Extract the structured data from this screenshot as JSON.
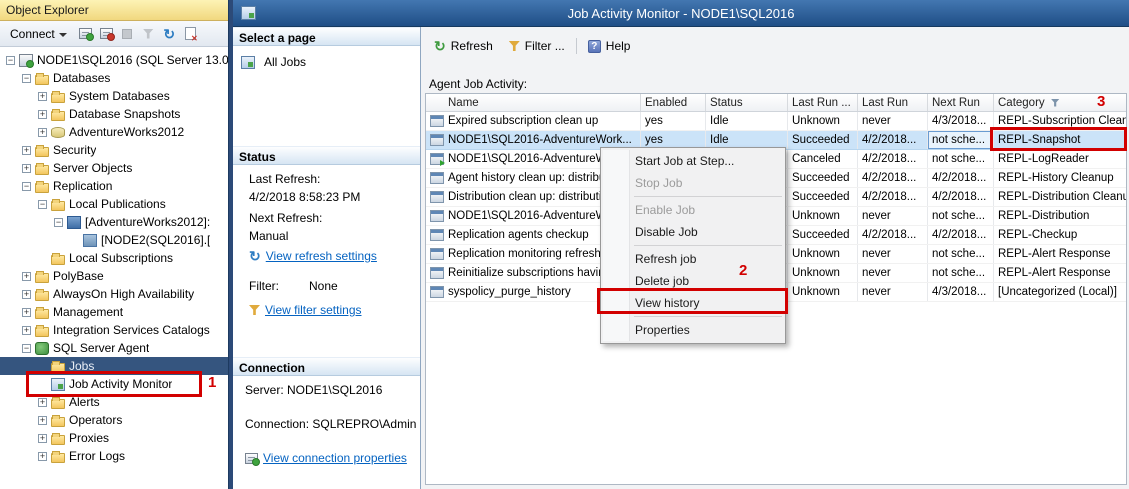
{
  "colors": {
    "annotation_red": "#d20000",
    "titlebar_blue": "#2a62a5",
    "selection_blue": "#cbe3f8",
    "link_blue": "#0563c1",
    "object_explorer_gold": "#f1d87f"
  },
  "object_explorer": {
    "title": "Object Explorer",
    "connect_label": "Connect",
    "tree": [
      {
        "label": "NODE1\\SQL2016 (SQL Server 13.0.",
        "level": 0,
        "expander": "minus",
        "icon": "server"
      },
      {
        "label": "Databases",
        "level": 1,
        "expander": "minus",
        "icon": "folder"
      },
      {
        "label": "System Databases",
        "level": 2,
        "expander": "plus",
        "icon": "folder"
      },
      {
        "label": "Database Snapshots",
        "level": 2,
        "expander": "plus",
        "icon": "folder"
      },
      {
        "label": "AdventureWorks2012",
        "level": 2,
        "expander": "plus",
        "icon": "database"
      },
      {
        "label": "Security",
        "level": 1,
        "expander": "plus",
        "icon": "folder"
      },
      {
        "label": "Server Objects",
        "level": 1,
        "expander": "plus",
        "icon": "folder"
      },
      {
        "label": "Replication",
        "level": 1,
        "expander": "minus",
        "icon": "folder"
      },
      {
        "label": "Local Publications",
        "level": 2,
        "expander": "minus",
        "icon": "folder"
      },
      {
        "label": "[AdventureWorks2012]:",
        "level": 3,
        "expander": "minus",
        "icon": "publication"
      },
      {
        "label": "[NODE2(SQL2016].[",
        "level": 4,
        "expander": "none",
        "icon": "subscription"
      },
      {
        "label": "Local Subscriptions",
        "level": 2,
        "expander": "none",
        "icon": "folder"
      },
      {
        "label": "PolyBase",
        "level": 1,
        "expander": "plus",
        "icon": "folder"
      },
      {
        "label": "AlwaysOn High Availability",
        "level": 1,
        "expander": "plus",
        "icon": "folder"
      },
      {
        "label": "Management",
        "level": 1,
        "expander": "plus",
        "icon": "folder"
      },
      {
        "label": "Integration Services Catalogs",
        "level": 1,
        "expander": "plus",
        "icon": "folder"
      },
      {
        "label": "SQL Server Agent",
        "level": 1,
        "expander": "minus",
        "icon": "agent"
      },
      {
        "label": "Jobs",
        "level": 2,
        "expander": "none",
        "icon": "folder",
        "selected": true
      },
      {
        "label": "Job Activity Monitor",
        "level": 2,
        "expander": "none",
        "icon": "monitor"
      },
      {
        "label": "Alerts",
        "level": 2,
        "expander": "plus",
        "icon": "folder"
      },
      {
        "label": "Operators",
        "level": 2,
        "expander": "plus",
        "icon": "folder"
      },
      {
        "label": "Proxies",
        "level": 2,
        "expander": "plus",
        "icon": "folder"
      },
      {
        "label": "Error Logs",
        "level": 2,
        "expander": "plus",
        "icon": "folder"
      }
    ]
  },
  "window": {
    "title": "Job Activity Monitor - NODE1\\SQL2016"
  },
  "select_page": {
    "header": "Select a page",
    "all_jobs_label": "All Jobs"
  },
  "status_panel": {
    "header": "Status",
    "last_refresh_label": "Last Refresh:",
    "last_refresh_value": "4/2/2018 8:58:23 PM",
    "next_refresh_label": "Next Refresh:",
    "next_refresh_value": "Manual",
    "refresh_link": "View refresh settings",
    "filter_label": "Filter:",
    "filter_value": "None",
    "filter_link": "View filter settings"
  },
  "connection_panel": {
    "header": "Connection",
    "server_line": "Server: NODE1\\SQL2016",
    "connection_line": "Connection: SQLREPRO\\Administra",
    "link": "View connection properties"
  },
  "toolbar": {
    "refresh": "Refresh",
    "filter": "Filter ...",
    "help": "Help"
  },
  "grid": {
    "label": "Agent Job Activity:",
    "columns": [
      "Name",
      "Enabled",
      "Status",
      "Last Run ...",
      "Last Run",
      "Next Run",
      "Category"
    ],
    "filtered_column": "Category",
    "rows": [
      {
        "name": "Expired subscription clean up",
        "enabled": "yes",
        "status": "Idle",
        "last_run_outcome": "Unknown",
        "last_run": "never",
        "next_run": "4/3/2018...",
        "category": "REPL-Subscription Clean..."
      },
      {
        "name": "NODE1\\SQL2016-AdventureWork...",
        "enabled": "yes",
        "status": "Idle",
        "last_run_outcome": "Succeeded",
        "last_run": "4/2/2018...",
        "next_run": "not sche...",
        "category": "REPL-Snapshot",
        "selected": true
      },
      {
        "name": "NODE1\\SQL2016-AdventureW",
        "enabled": "",
        "status": "",
        "last_run_outcome": "Canceled",
        "last_run": "4/2/2018...",
        "next_run": "not sche...",
        "category": "REPL-LogReader",
        "running": true
      },
      {
        "name": "Agent history clean up: distributi",
        "enabled": "",
        "status": "",
        "last_run_outcome": "Succeeded",
        "last_run": "4/2/2018...",
        "next_run": "4/2/2018...",
        "category": "REPL-History Cleanup"
      },
      {
        "name": "Distribution clean up: distribution",
        "enabled": "",
        "status": "",
        "last_run_outcome": "Succeeded",
        "last_run": "4/2/2018...",
        "next_run": "4/2/2018...",
        "category": "REPL-Distribution Cleanup"
      },
      {
        "name": "NODE1\\SQL2016-AdventureW",
        "enabled": "",
        "status": "",
        "last_run_outcome": "Unknown",
        "last_run": "never",
        "next_run": "not sche...",
        "category": "REPL-Distribution"
      },
      {
        "name": "Replication agents checkup",
        "enabled": "",
        "status": "",
        "last_run_outcome": "Succeeded",
        "last_run": "4/2/2018...",
        "next_run": "4/2/2018...",
        "category": "REPL-Checkup"
      },
      {
        "name": "Replication monitoring refresher",
        "enabled": "",
        "status": "",
        "last_run_outcome": "Unknown",
        "last_run": "never",
        "next_run": "not sche...",
        "category": "REPL-Alert Response"
      },
      {
        "name": "Reinitialize subscriptions having",
        "enabled": "",
        "status": "",
        "last_run_outcome": "Unknown",
        "last_run": "never",
        "next_run": "not sche...",
        "category": "REPL-Alert Response"
      },
      {
        "name": "syspolicy_purge_history",
        "enabled": "",
        "status": "",
        "last_run_outcome": "Unknown",
        "last_run": "never",
        "next_run": "4/3/2018...",
        "category": "[Uncategorized (Local)]"
      }
    ]
  },
  "context_menu": {
    "items": [
      {
        "type": "item",
        "label": "Start Job at Step...",
        "enabled": true
      },
      {
        "type": "item",
        "label": "Stop Job",
        "enabled": false
      },
      {
        "type": "separator"
      },
      {
        "type": "item",
        "label": "Enable Job",
        "enabled": false
      },
      {
        "type": "item",
        "label": "Disable Job",
        "enabled": true
      },
      {
        "type": "separator"
      },
      {
        "type": "item",
        "label": "Refresh job",
        "enabled": true
      },
      {
        "type": "item",
        "label": "Delete job",
        "enabled": true
      },
      {
        "type": "item",
        "label": "View history",
        "enabled": true
      },
      {
        "type": "separator"
      },
      {
        "type": "item",
        "label": "Properties",
        "enabled": true
      }
    ]
  },
  "annotations": {
    "label_1": "1",
    "label_2": "2",
    "label_3": "3"
  }
}
